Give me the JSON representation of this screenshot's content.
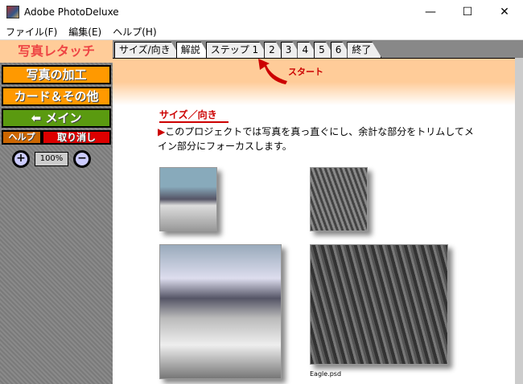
{
  "window": {
    "title": "Adobe PhotoDeluxe"
  },
  "menu": [
    "ファイル(F)",
    "編集(E)",
    "ヘルプ(H)"
  ],
  "sidebar": {
    "header": "写真レタッチ",
    "buttons": {
      "edit": "写真の加工",
      "cards": "カード＆その他",
      "main": "メイン",
      "help": "ヘルプ",
      "undo": "取り消し"
    },
    "zoom": "100%"
  },
  "tabs": [
    "サイズ/向き",
    "解説",
    "ステップ 1",
    "2",
    "3",
    "4",
    "5",
    "6",
    "終了"
  ],
  "content": {
    "start": "スタート",
    "heading": "サイズ／向き",
    "description": "このプロジェクトでは写真を真っ直ぐにし、余計な部分をトリムしてメイン部分にフォーカスします。",
    "caption": "Eagle.psd"
  }
}
